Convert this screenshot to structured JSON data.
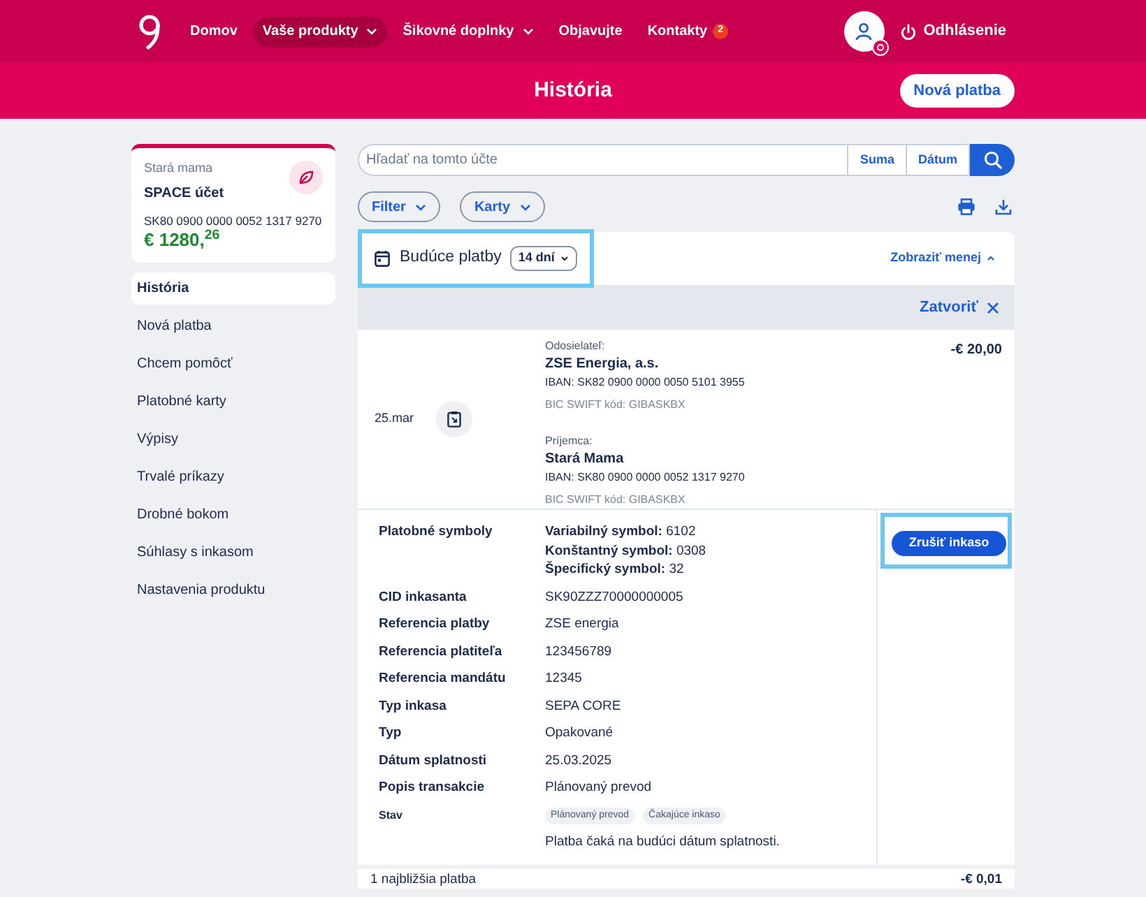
{
  "nav": {
    "items": [
      {
        "label": "Domov",
        "selected": false,
        "dropdown": false
      },
      {
        "label": "Vaše produkty",
        "selected": true,
        "dropdown": true
      },
      {
        "label": "Šikovné doplnky",
        "selected": false,
        "dropdown": true
      },
      {
        "label": "Objavujte",
        "selected": false,
        "dropdown": false
      },
      {
        "label": "Kontakty",
        "selected": false,
        "dropdown": false,
        "badge": "2"
      }
    ],
    "logout": "Odhlásenie"
  },
  "page_title": "História",
  "new_payment_button": "Nová platba",
  "account": {
    "owner": "Stará mama",
    "name": "SPACE účet",
    "iban": "SK80 0900 0000 0052 1317 9270",
    "balance": "€ 1280,$^{26}$"
  },
  "sidebar": {
    "items": [
      {
        "label": "História",
        "selected": true
      },
      {
        "label": "Nová platba",
        "selected": false
      },
      {
        "label": "Chcem pomôcť",
        "selected": false
      },
      {
        "label": "Platobné karty",
        "selected": false
      },
      {
        "label": "Výpisy",
        "selected": false
      },
      {
        "label": "Trvalé príkazy",
        "selected": false
      },
      {
        "label": "Drobné bokom",
        "selected": false
      },
      {
        "label": "Súhlasy s inkasom",
        "selected": false
      },
      {
        "label": "Nastavenia produktu",
        "selected": false
      }
    ]
  },
  "search": {
    "placeholder": "Hľadať na tomto účte",
    "buttons": [
      "Suma",
      "Dátum"
    ]
  },
  "filters": [
    "Filter",
    "Karty"
  ],
  "future_payments": {
    "title": "Budúce platby",
    "period": "14 dní",
    "highlighted": true,
    "toggle": "Zobraziť menej",
    "close": "Zatvoriť"
  },
  "transaction": {
    "date": "25.mar",
    "amount": "-€ 20,00",
    "sender": {
      "label": "Odosielateľ:",
      "name": "ZSE Energia, a.s.",
      "iban": "IBAN: SK82 0900 0000 0050 5101 3955",
      "bic": "BIC SWIFT kód: GIBASKBX"
    },
    "recipient": {
      "label": "Príjemca:",
      "name": "Stará Mama",
      "iban": "IBAN: SK80 0900 0000 0052 1317 9270",
      "bic": "BIC SWIFT kód: GIBASKBX"
    }
  },
  "details": [
    {
      "kind": "lines",
      "label": "Platobné symboly",
      "lines": [
        "**Variabilný symbol:** 6102",
        "**Konštantný symbol:** 0308",
        "**Špecifický symbol:** 32"
      ]
    },
    {
      "kind": "text",
      "label": "CID inkasanta",
      "value": "SK90ZZZ70000000005"
    },
    {
      "kind": "text",
      "label": "Referencia platby",
      "value": "ZSE energia"
    },
    {
      "kind": "text",
      "label": "Referencia platiteľa",
      "value": "123456789"
    },
    {
      "kind": "text",
      "label": "Referencia mandátu",
      "value": "12345"
    },
    {
      "kind": "text",
      "label": "Typ inkasa",
      "value": "SEPA CORE"
    },
    {
      "kind": "text",
      "label": "Typ",
      "value": "Opakované"
    },
    {
      "kind": "text",
      "label": "Dátum splatnosti",
      "value": "25.03.2025"
    },
    {
      "kind": "text",
      "label": "Popis transakcie",
      "value": "Plánovaný prevod"
    },
    {
      "kind": "tags",
      "label": "Stav",
      "tags": [
        "Plánovaný prevod",
        "Čakajúce inkaso"
      ],
      "note": "Platba čaká na budúci dátum splatnosti."
    }
  ],
  "cancel_button": {
    "label": "Zrušiť inkaso",
    "highlighted": true
  },
  "footer": {
    "count": "1 najbližšia platba",
    "amount": "-€ 0,01"
  }
}
